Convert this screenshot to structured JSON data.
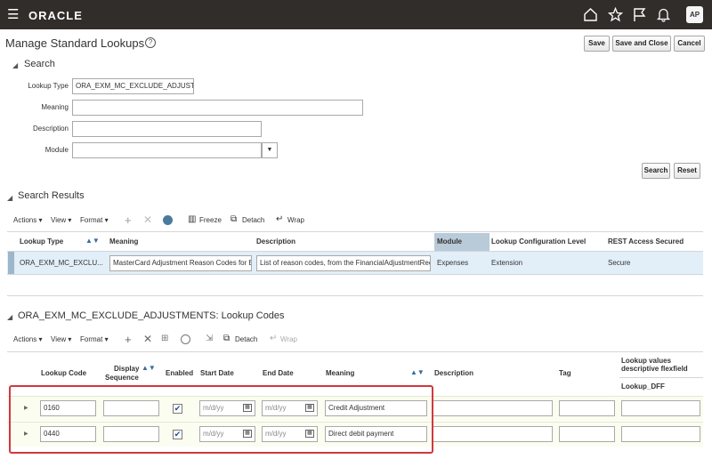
{
  "app": {
    "brand": "ORACLE",
    "avatar": "AP"
  },
  "page": {
    "title": "Manage Standard Lookups",
    "help": "?"
  },
  "actions": {
    "save": "Save",
    "save_close": "Save and Close",
    "cancel": "Cancel"
  },
  "search": {
    "title": "Search",
    "lookup_type_label": "Lookup Type",
    "lookup_type_value": "ORA_EXM_MC_EXCLUDE_ADJUSTM",
    "meaning_label": "Meaning",
    "meaning_value": "",
    "description_label": "Description",
    "description_value": "",
    "module_label": "Module",
    "module_value": "",
    "search_btn": "Search",
    "reset_btn": "Reset"
  },
  "results": {
    "title": "Search Results",
    "toolbar": {
      "actions": "Actions",
      "view": "View",
      "format": "Format",
      "freeze": "Freeze",
      "detach": "Detach",
      "wrap": "Wrap"
    },
    "columns": {
      "lookup_type": "Lookup Type",
      "meaning": "Meaning",
      "description": "Description",
      "module": "Module",
      "config_level": "Lookup Configuration Level",
      "rest_access": "REST Access Secured"
    },
    "row": {
      "lookup_type": "ORA_EXM_MC_EXCLU...",
      "meaning": "MasterCard Adjustment Reason Codes for E:",
      "description": "List of reason codes, from the FinancialAdjustmentReco",
      "module": "Expenses",
      "config_level": "Extension",
      "rest_access": "Secure"
    }
  },
  "codes": {
    "title": "ORA_EXM_MC_EXCLUDE_ADJUSTMENTS: Lookup Codes",
    "toolbar": {
      "actions": "Actions",
      "view": "View",
      "format": "Format",
      "detach": "Detach",
      "wrap": "Wrap"
    },
    "columns": {
      "lookup_code": "Lookup Code",
      "display_line1": "Display",
      "display_line2": "Sequence",
      "enabled": "Enabled",
      "start_date": "Start Date",
      "end_date": "End Date",
      "meaning": "Meaning",
      "description": "Description",
      "tag": "Tag",
      "flex_line1": "Lookup values",
      "flex_line2": "descriptive flexfield",
      "flex_sub": "Lookup_DFF"
    },
    "date_placeholder": "m/d/yy",
    "rows": [
      {
        "code": "0160",
        "enabled": true,
        "meaning": "Credit Adjustment"
      },
      {
        "code": "0440",
        "enabled": true,
        "meaning": "Direct debit payment"
      }
    ]
  }
}
